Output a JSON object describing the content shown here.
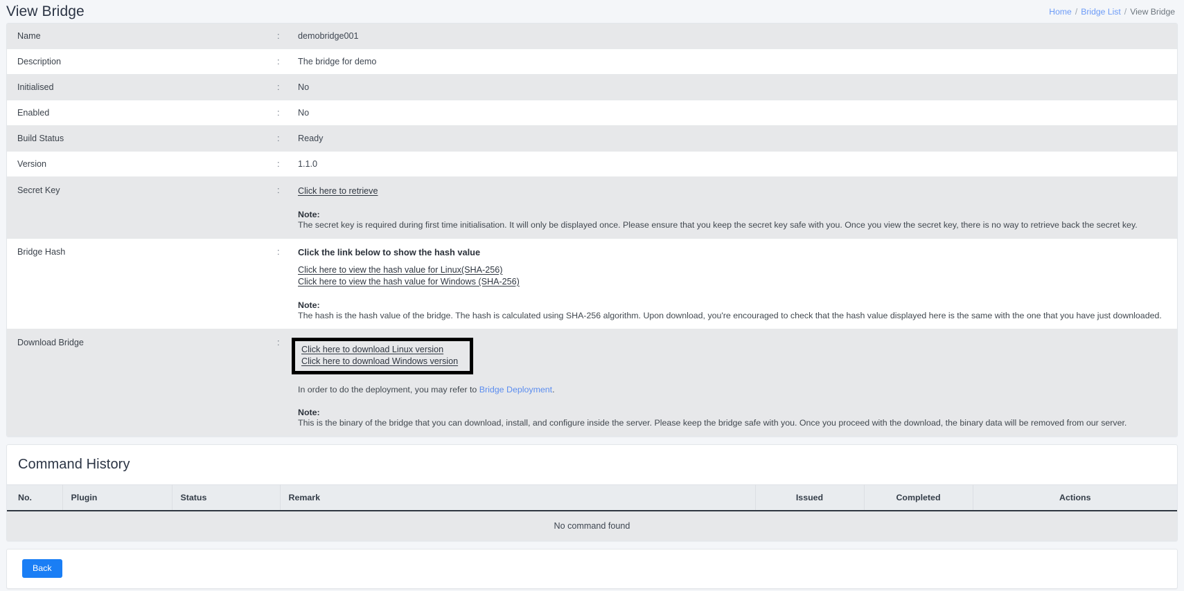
{
  "header": {
    "title": "View Bridge",
    "breadcrumb": [
      {
        "label": "Home",
        "link": true
      },
      {
        "label": "Bridge List",
        "link": true
      },
      {
        "label": "View Bridge",
        "link": false
      }
    ],
    "separator": "/"
  },
  "details": {
    "colon": ":",
    "name": {
      "label": "Name",
      "value": "demobridge001"
    },
    "description": {
      "label": "Description",
      "value": "The bridge for demo"
    },
    "initialised": {
      "label": "Initialised",
      "value": "No"
    },
    "enabled": {
      "label": "Enabled",
      "value": "No"
    },
    "build_status": {
      "label": "Build Status",
      "value": "Ready"
    },
    "version": {
      "label": "Version",
      "value": "1.1.0"
    },
    "secret_key": {
      "label": "Secret Key",
      "retrieve_link": "Click here to retrieve",
      "note_title": "Note:",
      "note_body": "The secret key is required during first time initialisation. It will only be displayed once. Please ensure that you keep the secret key safe with you. Once you view the secret key, there is no way to retrieve back the secret key."
    },
    "bridge_hash": {
      "label": "Bridge Hash",
      "heading": "Click the link below to show the hash value",
      "linux_link": "Click here to view the hash value for Linux(SHA-256)",
      "windows_link": "Click here to view the hash value for Windows (SHA-256)",
      "note_title": "Note:",
      "note_body": "The hash is the hash value of the bridge. The hash is calculated using SHA-256 algorithm. Upon download, you're encouraged to check that the hash value displayed here is the same with the one that you have just downloaded."
    },
    "download_bridge": {
      "label": "Download Bridge",
      "linux_link": "Click here to download Linux version",
      "windows_link": "Click here to download Windows version",
      "deploy_prefix": "In order to do the deployment, you may refer to ",
      "deploy_link": "Bridge Deployment",
      "deploy_suffix": ".",
      "note_title": "Note:",
      "note_body": "This is the binary of the bridge that you can download, install, and configure inside the server. Please keep the bridge safe with you. Once you proceed with the download, the binary data will be removed from our server."
    }
  },
  "command_history": {
    "title": "Command History",
    "columns": [
      "No.",
      "Plugin",
      "Status",
      "Remark",
      "Issued",
      "Completed",
      "Actions"
    ],
    "empty_message": "No command found",
    "rows": []
  },
  "footer": {
    "back_label": "Back"
  },
  "colors": {
    "accent_button": "#1a7ef5",
    "breadcrumb_link": "#6c9bf7",
    "inline_link": "#5b8def",
    "highlight_box": "#000000",
    "page_bg": "#f4f6f9",
    "row_striped": "#e7e8ea"
  }
}
